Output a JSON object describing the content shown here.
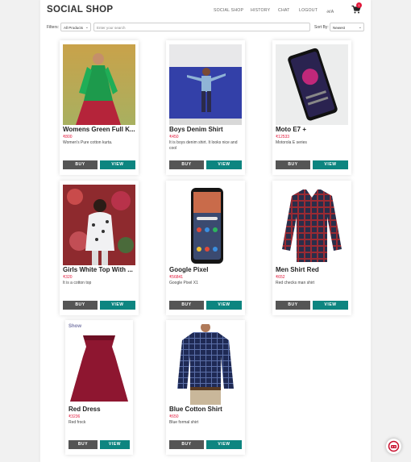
{
  "header": {
    "brand": "SOCIAL SHOP",
    "nav": [
      "SOCIAL SHOP",
      "HISTORY",
      "CHAT",
      "LOGOUT",
      "अ/A"
    ],
    "cart_count": "1"
  },
  "filters": {
    "label": "Filters:",
    "category": "All Products",
    "search_placeholder": "Enter your search",
    "sort_label": "Sort By:",
    "sort_value": "Newest"
  },
  "buttons": {
    "buy": "BUY",
    "view": "VIEW"
  },
  "products": [
    {
      "title": "Womens Green Full K...",
      "price": "₹800",
      "desc": "Women's Pure cotton kurta."
    },
    {
      "title": "Boys Denim Shirt",
      "price": "₹450",
      "desc": "It is boys denim shirt. It looks nice and cool"
    },
    {
      "title": "Moto E7 +",
      "price": "₹12533",
      "desc": "Motorola E series"
    },
    {
      "title": "Girls White Top With ...",
      "price": "₹320",
      "desc": "It is a cotton top"
    },
    {
      "title": "Google Pixel",
      "price": "₹56841",
      "desc": "Google Pixel X1"
    },
    {
      "title": "Men Shirt Red",
      "price": "₹652",
      "desc": "Red checks man shirt"
    },
    {
      "title": "Red Dress",
      "price": "₹3236",
      "desc": "Red frock",
      "badge": "Show"
    },
    {
      "title": "Blue Cotton Shirt",
      "price": "₹650",
      "desc": "Blue formal shirt"
    }
  ],
  "colors": {
    "accent": "#0d8580",
    "buy": "#555555",
    "price": "#e2183b"
  }
}
